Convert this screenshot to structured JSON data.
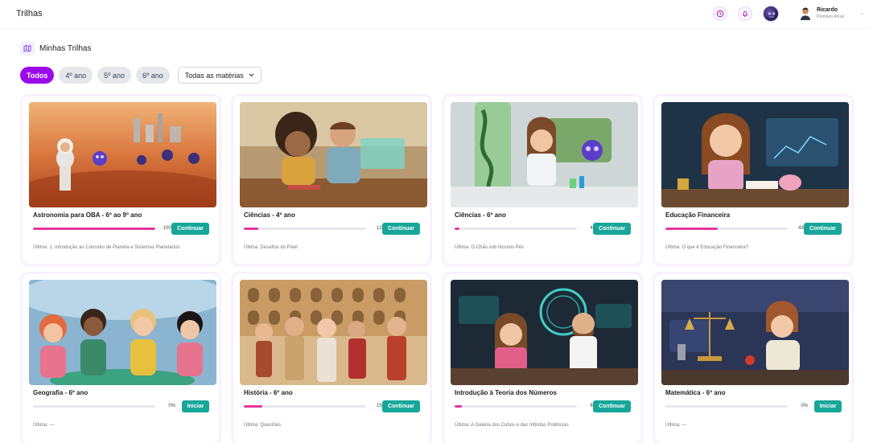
{
  "header": {
    "title": "Trilhas",
    "user": {
      "name": "Ricardo",
      "plan": "Premium Anual"
    }
  },
  "section": {
    "title": "Minhas Trilhas"
  },
  "filters": {
    "chips": [
      "Todos",
      "4º ano",
      "5º ano",
      "6º ano"
    ],
    "active": "Todos",
    "dropdown_value": "Todas as matérias"
  },
  "cards": [
    {
      "title": "Astronomia para OBA - 6º ao 9º ano",
      "progress": 100,
      "progress_label": "100%",
      "action": "Continuar",
      "last": "Última: 1. Introdução ao Conceito de Planeta e Sistemas Planetários"
    },
    {
      "title": "Ciências - 4º ano",
      "progress": 12,
      "progress_label": "12%",
      "action": "Continuar",
      "last": "Última: Desafios do Pixel"
    },
    {
      "title": "Ciências - 6º ano",
      "progress": 4,
      "progress_label": "4%",
      "action": "Continuar",
      "last": "Última: O Chão sob Nossos Pés"
    },
    {
      "title": "Educação Financeira",
      "progress": 43,
      "progress_label": "43%",
      "action": "Continuar",
      "last": "Última: O que é Educação Financeira?"
    },
    {
      "title": "Geografia - 6º ano",
      "progress": 0,
      "progress_label": "0%",
      "action": "Iniciar",
      "last": "Última: —"
    },
    {
      "title": "História - 6º ano",
      "progress": 15,
      "progress_label": "15%",
      "action": "Continuar",
      "last": "Última: Questões"
    },
    {
      "title": "Introdução à Teoria dos Números",
      "progress": 6,
      "progress_label": "6%",
      "action": "Continuar",
      "last": "Última: A Galeria dos Cubos e das Infinitas Potências"
    },
    {
      "title": "Matemática - 6º ano",
      "progress": 0,
      "progress_label": "0%",
      "action": "Iniciar",
      "last": "Última: —"
    }
  ],
  "colors": {
    "accent": "#9b0bea",
    "progress": "#e5359e",
    "button": "#17a699"
  },
  "icons": [
    "clock-icon",
    "bell-icon",
    "map-icon",
    "chevron-down-icon"
  ]
}
